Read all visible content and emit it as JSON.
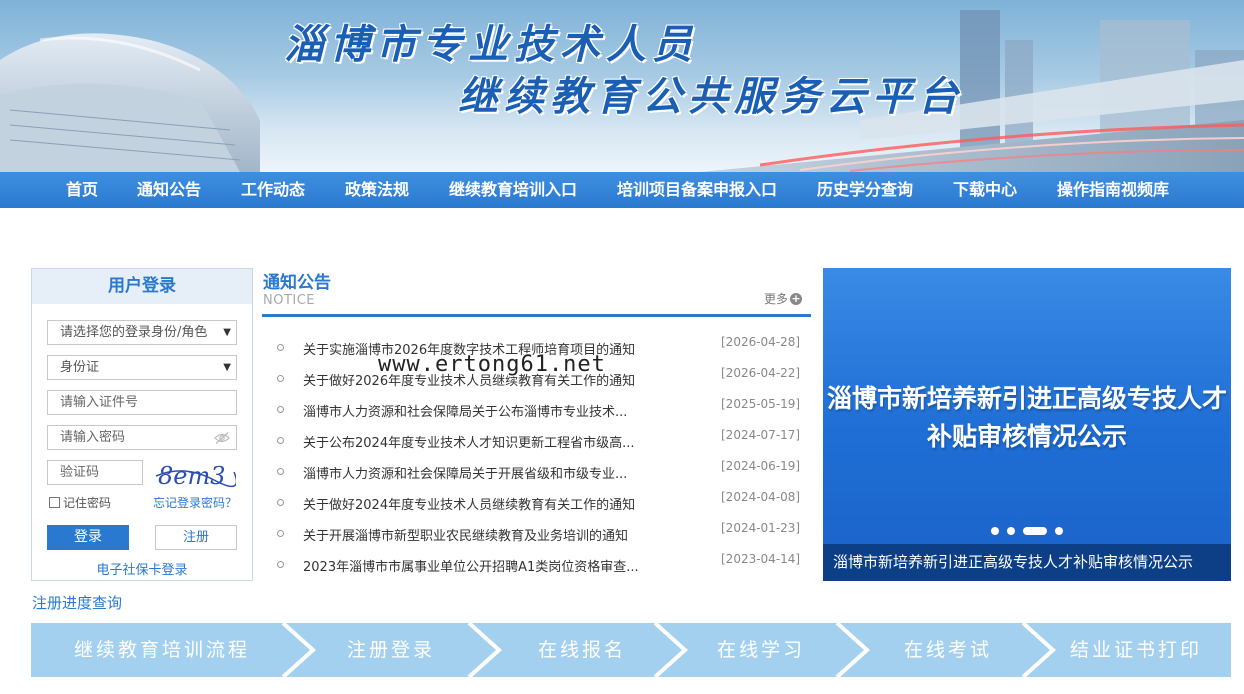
{
  "banner": {
    "title_line1": "淄博市专业技术人员",
    "title_line2": "继续教育公共服务云平台"
  },
  "nav": {
    "items": [
      "首页",
      "通知公告",
      "工作动态",
      "政策法规",
      "继续教育培训入口",
      "培训项目备案申报入口",
      "历史学分查询",
      "下载中心",
      "操作指南视频库"
    ]
  },
  "login": {
    "title": "用户登录",
    "role_select": "请选择您的登录身份/角色",
    "id_type_select": "身份证",
    "id_number_placeholder": "请输入证件号",
    "password_placeholder": "请输入密码",
    "captcha_placeholder": "验证码",
    "captcha_text": "8em3",
    "remember": "记住密码",
    "forgot": "忘记登录密码？",
    "login_button": "登录",
    "register_button": "注册",
    "social_card_login": "电子社保卡登录"
  },
  "register_progress": "注册进度查询",
  "notice": {
    "title": "通知公告",
    "subtitle": "NOTICE",
    "more": "更多",
    "items": [
      {
        "text": "关于实施淄博市2026年度数字技术工程师培育项目的通知",
        "date": "[2026-04-28]"
      },
      {
        "text": "关于做好2026年度专业技术人员继续教育有关工作的通知",
        "date": "[2026-04-22]"
      },
      {
        "text": "淄博市人力资源和社会保障局关于公布淄博市专业技术...",
        "date": "[2025-05-19]"
      },
      {
        "text": "关于公布2024年度专业技术人才知识更新工程省市级高...",
        "date": "[2024-07-17]"
      },
      {
        "text": "淄博市人力资源和社会保障局关于开展省级和市级专业...",
        "date": "[2024-06-19]"
      },
      {
        "text": "关于做好2024年度专业技术人员继续教育有关工作的通知",
        "date": "[2024-04-08]"
      },
      {
        "text": "关于开展淄博市新型职业农民继续教育及业务培训的通知",
        "date": "[2024-01-23]"
      },
      {
        "text": "2023年淄博市市属事业单位公开招聘A1类岗位资格审查...",
        "date": "[2023-04-14]"
      }
    ]
  },
  "watermark": "www.ertong61.net",
  "slide": {
    "headline_line1": "淄博市新培养新引进正高级专技人才",
    "headline_line2": "补贴审核情况公示",
    "caption": "淄博市新培养新引进正高级专技人才补贴审核情况公示",
    "dot_count": 4,
    "active_dot": 3
  },
  "process": {
    "steps": [
      "继续教育培训流程",
      "注册登录",
      "在线报名",
      "在线学习",
      "在线考试",
      "结业证书打印"
    ]
  },
  "colors": {
    "primary": "#2a79d0",
    "nav_bg": "#3686da",
    "caption_bg": "#0d3f86",
    "process_bg": "#a4d0f0"
  }
}
